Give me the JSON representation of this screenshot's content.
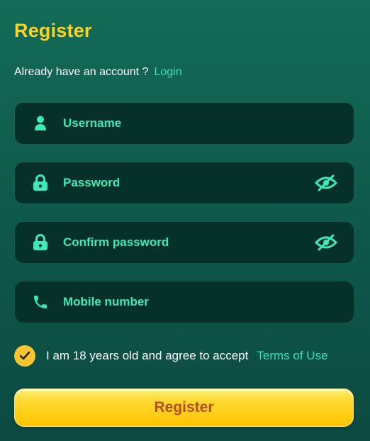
{
  "title": "Register",
  "account": {
    "prompt": "Already have an account ?",
    "login_label": "Login"
  },
  "fields": [
    {
      "placeholder": "Username",
      "icon": "user-icon"
    },
    {
      "placeholder": "Password",
      "icon": "lock-icon",
      "toggle_icon": "eye-slash-icon"
    },
    {
      "placeholder": "Confirm password",
      "icon": "lock-icon",
      "toggle_icon": "eye-slash-icon"
    },
    {
      "placeholder": "Mobile number",
      "icon": "phone-icon"
    }
  ],
  "terms": {
    "checked": true,
    "text": "I am 18 years old and agree to accept",
    "link_label": "Terms of Use"
  },
  "submit_label": "Register",
  "colors": {
    "accent": "#3ce9b9",
    "title": "#ffd21f",
    "field_bg": "#06312b",
    "button": "#ffc400",
    "button_text": "#b4501c"
  }
}
